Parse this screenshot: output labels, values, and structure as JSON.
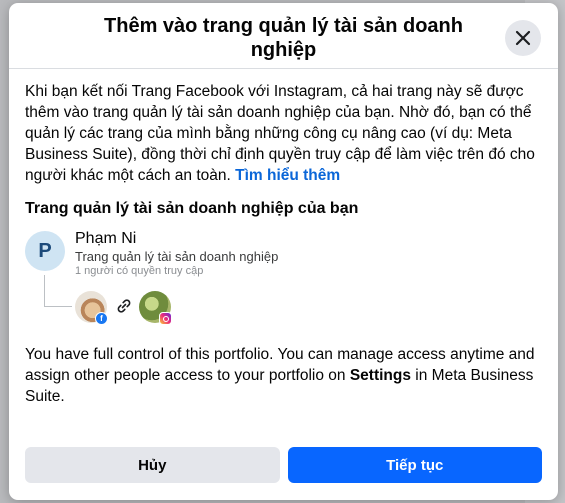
{
  "dialog": {
    "title": "Thêm vào trang quản lý tài sản doanh nghiệp",
    "intro": "Khi bạn kết nối Trang Facebook với Instagram, cả hai trang này sẽ được thêm vào trang quản lý tài sản doanh nghiệp của bạn. Nhờ đó, bạn có thể quản lý các trang của mình bằng những công cụ nâng cao (ví dụ: Meta Business Suite), đồng thời chỉ định quyền truy cập để làm việc trên đó cho người khác một cách an toàn.",
    "learn_more": "Tìm hiểu thêm",
    "section_title": "Trang quản lý tài sản doanh nghiệp của bạn"
  },
  "portfolio": {
    "avatar_letter": "P",
    "name": "Phạm Ni",
    "type": "Trang quản lý tài sản doanh nghiệp",
    "access": "1 người có quyền truy cập"
  },
  "footer": {
    "text_before": "You have full control of this portfolio. You can manage access anytime and assign other people access to your portfolio on ",
    "settings": "Settings",
    "text_after": " in Meta Business Suite."
  },
  "buttons": {
    "cancel": "Hủy",
    "continue": "Tiếp tục"
  },
  "icons": {
    "close": "close-icon",
    "link": "link-icon",
    "facebook": "facebook-badge-icon",
    "instagram": "instagram-badge-icon"
  },
  "colors": {
    "primary": "#0866ff",
    "link": "#0a66d8"
  }
}
